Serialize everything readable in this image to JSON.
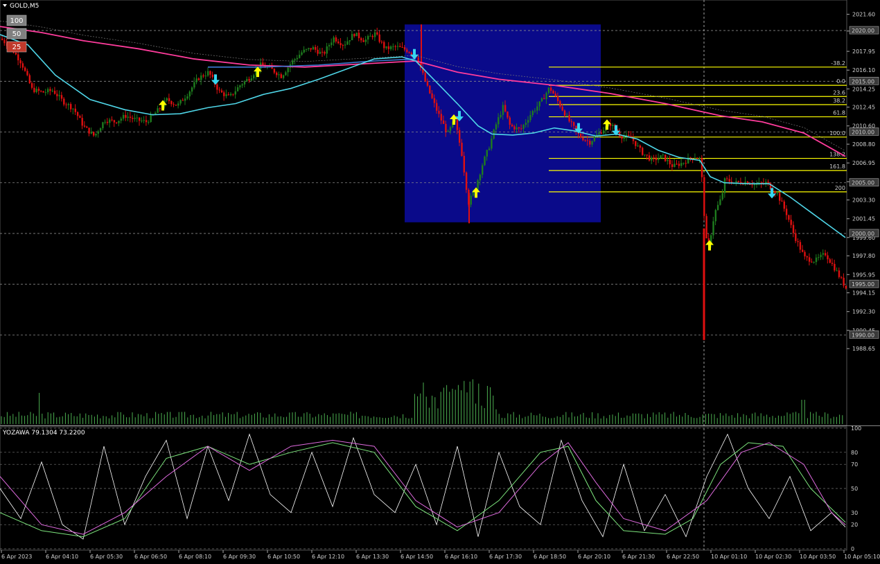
{
  "window_title": "GOLD,M5",
  "ma_badges": [
    {
      "label": "100",
      "color": "#808080"
    },
    {
      "label": "50",
      "color": "#808080"
    },
    {
      "label": "25",
      "color": "#c0392b"
    }
  ],
  "indicator_label": "YOZAWA 79.1304 73.2200",
  "colors": {
    "bull": "#1e7d1e",
    "bear": "#e01010",
    "ma_slow": "#ff3c9c",
    "ma_fast": "#4fd6e8",
    "ma_mid": "#3d7bd6",
    "fib": "#ffff00",
    "zone": "#0a0a8a",
    "up_arrow": "#ffff00",
    "down_arrow": "#36d6f0"
  },
  "chart_data": {
    "type": "candlestick",
    "symbol": "GOLD",
    "timeframe": "M5",
    "ylim": [
      1987.5,
      2022.6
    ],
    "price_ticks": [
      "2021.60",
      "2019.95",
      "2017.95",
      "2016.10",
      "2014.25",
      "2012.45",
      "2010.60",
      "2008.80",
      "2006.95",
      "2005.10",
      "2003.30",
      "2001.45",
      "1999.60",
      "1997.80",
      "1995.95",
      "1994.15",
      "1992.30",
      "1990.45",
      "1988.65"
    ],
    "price_labels": [
      "2020.00",
      "2015.00",
      "2010.00",
      "2005.00",
      "2000.00",
      "1995.00",
      "1990.00"
    ],
    "time_labels": [
      "6 Apr 2023",
      "6 Apr 04:10",
      "6 Apr 05:30",
      "6 Apr 06:50",
      "6 Apr 08:10",
      "6 Apr 09:30",
      "6 Apr 10:50",
      "6 Apr 12:10",
      "6 Apr 13:30",
      "6 Apr 14:50",
      "6 Apr 16:10",
      "6 Apr 17:30",
      "6 Apr 18:50",
      "6 Apr 20:10",
      "6 Apr 21:30",
      "6 Apr 22:50",
      "10 Apr 01:10",
      "10 Apr 02:30",
      "10 Apr 03:50",
      "10 Apr 05:10"
    ],
    "fib_levels": [
      {
        "label": "-38.2",
        "price": 2016.4
      },
      {
        "label": "0.0",
        "price": 2014.6
      },
      {
        "label": "23.6",
        "price": 2013.5
      },
      {
        "label": "38.2",
        "price": 2012.7
      },
      {
        "label": "61.8",
        "price": 2011.5
      },
      {
        "label": "100.0",
        "price": 2009.5
      },
      {
        "label": "138.2",
        "price": 2007.4
      },
      {
        "label": "161.8",
        "price": 2006.2
      },
      {
        "label": "200",
        "price": 2004.1
      }
    ],
    "highlight_zone": {
      "price_top": 2020.6,
      "price_bottom": 2001.1
    },
    "close_path": [
      [
        0,
        2019.2
      ],
      [
        15,
        2018.3
      ],
      [
        30,
        2016.8
      ],
      [
        45,
        2014.2
      ],
      [
        60,
        2013.9
      ],
      [
        75,
        2014.1
      ],
      [
        90,
        2013.0
      ],
      [
        105,
        2012.3
      ],
      [
        120,
        2010.5
      ],
      [
        135,
        2009.6
      ],
      [
        150,
        2011.2
      ],
      [
        165,
        2011.0
      ],
      [
        180,
        2011.6
      ],
      [
        195,
        2011.2
      ],
      [
        210,
        2011.0
      ],
      [
        225,
        2012.0
      ],
      [
        240,
        2013.2
      ],
      [
        255,
        2012.6
      ],
      [
        270,
        2013.8
      ],
      [
        285,
        2015.3
      ],
      [
        300,
        2015.9
      ],
      [
        315,
        2014.0
      ],
      [
        330,
        2013.4
      ],
      [
        345,
        2014.6
      ],
      [
        360,
        2015.4
      ],
      [
        375,
        2016.6
      ],
      [
        390,
        2016.2
      ],
      [
        405,
        2015.5
      ],
      [
        420,
        2016.9
      ],
      [
        435,
        2017.9
      ],
      [
        450,
        2018.3
      ],
      [
        465,
        2017.6
      ],
      [
        480,
        2019.3
      ],
      [
        495,
        2018.6
      ],
      [
        510,
        2019.7
      ],
      [
        525,
        2019.0
      ],
      [
        540,
        2019.7
      ],
      [
        555,
        2018.2
      ],
      [
        570,
        2018.4
      ],
      [
        585,
        2018.1
      ],
      [
        600,
        2017.5
      ],
      [
        615,
        2014.5
      ],
      [
        630,
        2012.0
      ],
      [
        645,
        2009.8
      ],
      [
        655,
        2011.2
      ],
      [
        665,
        2008.0
      ],
      [
        675,
        2003.0
      ],
      [
        685,
        2004.5
      ],
      [
        695,
        2006.8
      ],
      [
        705,
        2008.6
      ],
      [
        715,
        2010.8
      ],
      [
        725,
        2012.5
      ],
      [
        735,
        2010.6
      ],
      [
        750,
        2010.2
      ],
      [
        765,
        2011.8
      ],
      [
        780,
        2013.0
      ],
      [
        792,
        2014.4
      ],
      [
        805,
        2012.9
      ],
      [
        820,
        2011.1
      ],
      [
        835,
        2009.6
      ],
      [
        850,
        2009.0
      ],
      [
        865,
        2010.0
      ],
      [
        880,
        2010.8
      ],
      [
        895,
        2009.6
      ],
      [
        910,
        2009.4
      ],
      [
        925,
        2008.0
      ],
      [
        940,
        2007.2
      ],
      [
        955,
        2007.6
      ],
      [
        970,
        2006.6
      ],
      [
        985,
        2007.0
      ],
      [
        1000,
        2007.6
      ],
      [
        1010,
        2007.3
      ],
      [
        1015,
        2002.0
      ],
      [
        1020,
        1998.0
      ],
      [
        1030,
        2002.0
      ],
      [
        1040,
        2003.5
      ],
      [
        1045,
        2005.3
      ],
      [
        1060,
        2005.0
      ],
      [
        1075,
        2005.1
      ],
      [
        1090,
        2004.8
      ],
      [
        1105,
        2005.0
      ],
      [
        1120,
        2004.0
      ],
      [
        1135,
        2001.8
      ],
      [
        1145,
        1999.8
      ],
      [
        1160,
        1997.6
      ],
      [
        1175,
        1997.3
      ],
      [
        1190,
        1998.0
      ],
      [
        1205,
        1996.4
      ],
      [
        1220,
        1994.6
      ]
    ],
    "ma_fast": [
      [
        0,
        2019.6
      ],
      [
        40,
        2018.6
      ],
      [
        80,
        2015.6
      ],
      [
        130,
        2013.2
      ],
      [
        180,
        2012.2
      ],
      [
        220,
        2011.7
      ],
      [
        260,
        2011.8
      ],
      [
        300,
        2012.4
      ],
      [
        340,
        2012.8
      ],
      [
        380,
        2013.7
      ],
      [
        420,
        2014.3
      ],
      [
        460,
        2015.2
      ],
      [
        500,
        2016.2
      ],
      [
        540,
        2017.2
      ],
      [
        580,
        2017.4
      ],
      [
        600,
        2017.0
      ],
      [
        630,
        2014.9
      ],
      [
        660,
        2012.8
      ],
      [
        690,
        2010.6
      ],
      [
        710,
        2009.8
      ],
      [
        740,
        2009.7
      ],
      [
        770,
        2009.9
      ],
      [
        800,
        2010.4
      ],
      [
        830,
        2010.1
      ],
      [
        860,
        2009.6
      ],
      [
        890,
        2009.8
      ],
      [
        920,
        2009.3
      ],
      [
        950,
        2008.2
      ],
      [
        980,
        2007.5
      ],
      [
        1010,
        2007.2
      ],
      [
        1025,
        2005.6
      ],
      [
        1045,
        2005.0
      ],
      [
        1080,
        2004.9
      ],
      [
        1110,
        2004.9
      ],
      [
        1140,
        2003.6
      ],
      [
        1170,
        2002.1
      ],
      [
        1200,
        2000.6
      ],
      [
        1220,
        1999.6
      ]
    ],
    "ma_mid": [
      [
        300,
        2016.4
      ],
      [
        380,
        2016.4
      ],
      [
        460,
        2016.6
      ],
      [
        540,
        2017.0
      ],
      [
        600,
        2017.2
      ]
    ],
    "ma_slow": [
      [
        0,
        2020.4
      ],
      [
        60,
        2019.8
      ],
      [
        120,
        2019.0
      ],
      [
        200,
        2018.2
      ],
      [
        280,
        2017.2
      ],
      [
        360,
        2016.6
      ],
      [
        440,
        2016.4
      ],
      [
        520,
        2016.7
      ],
      [
        600,
        2017.0
      ],
      [
        660,
        2015.9
      ],
      [
        720,
        2015.2
      ],
      [
        800,
        2014.6
      ],
      [
        880,
        2013.8
      ],
      [
        960,
        2012.8
      ],
      [
        1040,
        2011.6
      ],
      [
        1100,
        2011.0
      ],
      [
        1160,
        2009.9
      ],
      [
        1220,
        2007.6
      ]
    ],
    "up_arrows": [
      [
        235,
        2012.6
      ],
      [
        372,
        2015.9
      ],
      [
        655,
        2011.2
      ],
      [
        687,
        2004.0
      ],
      [
        876,
        2010.7
      ],
      [
        1024,
        1998.8
      ]
    ],
    "down_arrows": [
      [
        311,
        2015.2
      ],
      [
        598,
        2017.7
      ],
      [
        663,
        2011.6
      ],
      [
        835,
        2010.4
      ],
      [
        889,
        2010.2
      ],
      [
        1114,
        2004.0
      ]
    ],
    "volume_ylim": [
      0,
      100
    ],
    "oscillator": {
      "name": "YOZAWA",
      "values": [
        79.1304,
        73.22
      ],
      "ylim": [
        0,
        100
      ],
      "levels": [
        100,
        80,
        70,
        50,
        30,
        20,
        0
      ],
      "series": [
        {
          "color": "#ffffff",
          "points": [
            [
              0,
              50
            ],
            [
              30,
              25
            ],
            [
              60,
              72
            ],
            [
              90,
              20
            ],
            [
              120,
              8
            ],
            [
              150,
              85
            ],
            [
              180,
              20
            ],
            [
              210,
              60
            ],
            [
              240,
              90
            ],
            [
              270,
              25
            ],
            [
              300,
              85
            ],
            [
              330,
              40
            ],
            [
              360,
              95
            ],
            [
              390,
              45
            ],
            [
              420,
              30
            ],
            [
              450,
              80
            ],
            [
              480,
              35
            ],
            [
              510,
              92
            ],
            [
              540,
              45
            ],
            [
              570,
              30
            ],
            [
              600,
              70
            ],
            [
              630,
              20
            ],
            [
              660,
              85
            ],
            [
              690,
              10
            ],
            [
              720,
              80
            ],
            [
              750,
              35
            ],
            [
              780,
              20
            ],
            [
              810,
              90
            ],
            [
              840,
              40
            ],
            [
              870,
              10
            ],
            [
              900,
              70
            ],
            [
              930,
              15
            ],
            [
              960,
              45
            ],
            [
              990,
              10
            ],
            [
              1020,
              60
            ],
            [
              1050,
              95
            ],
            [
              1080,
              50
            ],
            [
              1110,
              25
            ],
            [
              1140,
              60
            ],
            [
              1170,
              15
            ],
            [
              1200,
              30
            ],
            [
              1220,
              18
            ]
          ]
        },
        {
          "color": "#7de67d",
          "points": [
            [
              0,
              30
            ],
            [
              60,
              15
            ],
            [
              120,
              10
            ],
            [
              180,
              25
            ],
            [
              240,
              75
            ],
            [
              300,
              85
            ],
            [
              360,
              70
            ],
            [
              420,
              80
            ],
            [
              480,
              88
            ],
            [
              540,
              80
            ],
            [
              600,
              35
            ],
            [
              660,
              15
            ],
            [
              720,
              40
            ],
            [
              780,
              80
            ],
            [
              820,
              85
            ],
            [
              860,
              40
            ],
            [
              900,
              15
            ],
            [
              960,
              12
            ],
            [
              1000,
              25
            ],
            [
              1040,
              70
            ],
            [
              1080,
              88
            ],
            [
              1130,
              85
            ],
            [
              1170,
              50
            ],
            [
              1220,
              22
            ]
          ]
        },
        {
          "color": "#e06be0",
          "points": [
            [
              0,
              60
            ],
            [
              60,
              20
            ],
            [
              120,
              12
            ],
            [
              180,
              30
            ],
            [
              240,
              60
            ],
            [
              300,
              85
            ],
            [
              360,
              65
            ],
            [
              420,
              85
            ],
            [
              480,
              90
            ],
            [
              540,
              85
            ],
            [
              600,
              40
            ],
            [
              660,
              18
            ],
            [
              720,
              30
            ],
            [
              780,
              70
            ],
            [
              820,
              88
            ],
            [
              860,
              55
            ],
            [
              900,
              25
            ],
            [
              960,
              15
            ],
            [
              1020,
              40
            ],
            [
              1070,
              80
            ],
            [
              1110,
              88
            ],
            [
              1160,
              70
            ],
            [
              1200,
              30
            ],
            [
              1220,
              20
            ]
          ]
        }
      ]
    }
  }
}
